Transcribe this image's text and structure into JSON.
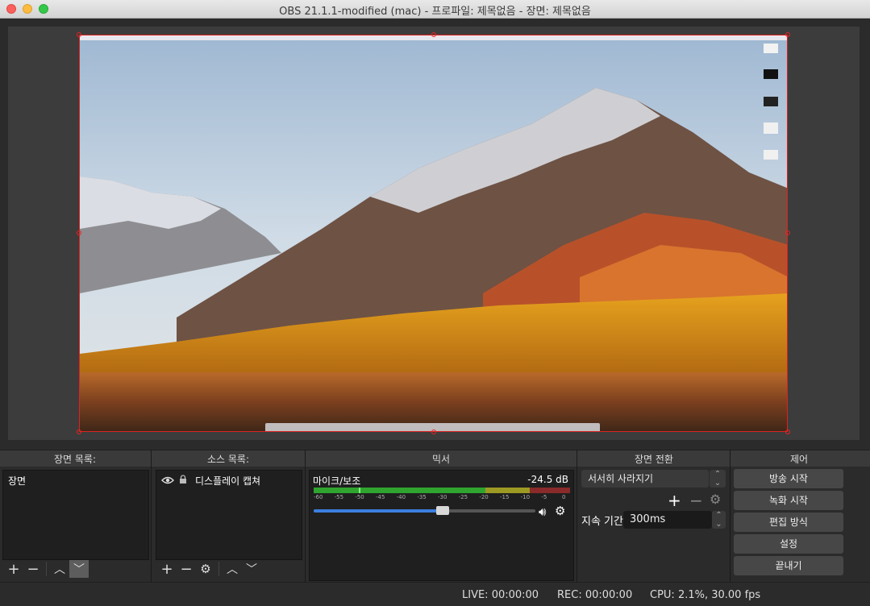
{
  "window": {
    "title": "OBS 21.1.1-modified (mac) - 프로파일: 제목없음 - 장면: 제목없음"
  },
  "panels": {
    "scenes": {
      "header": "장면 목록:",
      "items": [
        "장면"
      ]
    },
    "sources": {
      "header": "소스 목록:",
      "items": [
        {
          "label": "디스플레이 캡쳐",
          "visible": true,
          "locked": true
        }
      ]
    },
    "mixer": {
      "header": "믹서",
      "channel": "마이크/보조",
      "db": "-24.5 dB",
      "ticks": [
        "-60",
        "-55",
        "-50",
        "-45",
        "-40",
        "-35",
        "-30",
        "-25",
        "-20",
        "-15",
        "-10",
        "-5",
        "0"
      ],
      "volume_fraction": 0.58
    },
    "transitions": {
      "header": "장면 전환",
      "selected": "서서히 사라지기",
      "duration_label": "지속 기간",
      "duration_value": "300ms"
    },
    "controls": {
      "header": "제어",
      "start_stream": "방송 시작",
      "start_record": "녹화 시작",
      "studio_mode": "편집 방식",
      "settings": "설정",
      "exit": "끝내기"
    }
  },
  "status": {
    "live": "LIVE: 00:00:00",
    "rec": "REC: 00:00:00",
    "cpu": "CPU: 2.1%, 30.00 fps"
  },
  "colors": {
    "selection_border": "#dd2222",
    "meter_green": "#2fa52f",
    "meter_yellow": "#c9c32a",
    "meter_red": "#c43232",
    "slider_blue": "#3b7fe0"
  }
}
